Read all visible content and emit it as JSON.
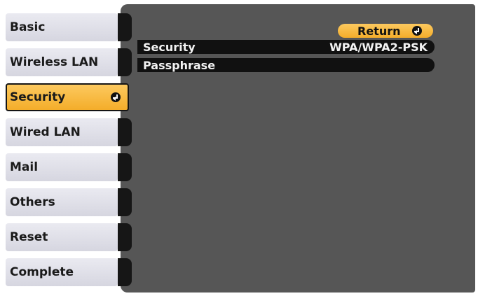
{
  "menu": {
    "items": [
      {
        "label": "Basic",
        "active": false
      },
      {
        "label": "Wireless LAN",
        "active": false
      },
      {
        "label": "Security",
        "active": true
      },
      {
        "label": "Wired LAN",
        "active": false
      },
      {
        "label": "Mail",
        "active": false
      },
      {
        "label": "Others",
        "active": false
      },
      {
        "label": "Reset",
        "active": false
      },
      {
        "label": "Complete",
        "active": false
      }
    ]
  },
  "content": {
    "return_label": "Return",
    "rows": [
      {
        "name": "Security",
        "value": "WPA/WPA2-PSK"
      },
      {
        "name": "Passphrase",
        "value": ""
      }
    ]
  },
  "colors": {
    "panel": "#565656",
    "highlight": "#f4ad2a",
    "row": "#111111",
    "tab": "#e0e0e8"
  },
  "icons": {
    "enter": "enter-icon"
  }
}
